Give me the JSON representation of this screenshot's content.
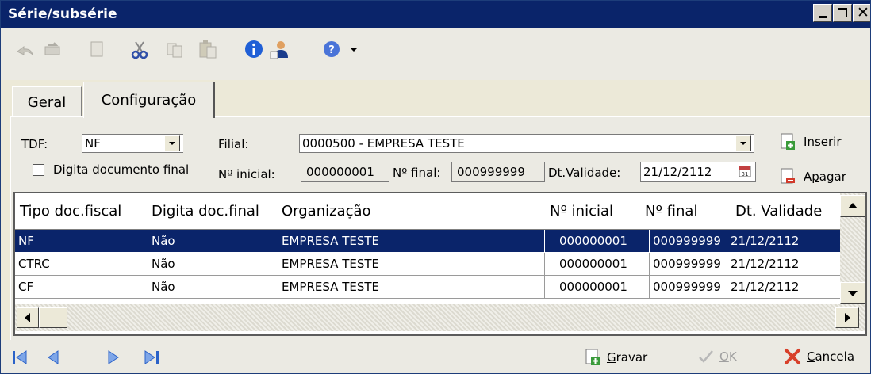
{
  "window": {
    "title": "Série/subsérie"
  },
  "toolbar": {
    "icons": [
      "undo-icon",
      "redo-icon",
      "new-document-icon",
      "cut-icon",
      "copy-icon",
      "paste-icon",
      "info-icon",
      "user-icon",
      "help-icon",
      "dropdown-arrow-icon"
    ]
  },
  "tabs": [
    {
      "label": "Geral",
      "active": false
    },
    {
      "label": "Configuração",
      "active": true
    }
  ],
  "form": {
    "tdf_label": "TDF:",
    "tdf_value": "NF",
    "filial_label": "Filial:",
    "filial_value": "0000500 - EMPRESA TESTE",
    "digita_label": "Digita documento final",
    "digita_checked": false,
    "num_inicial_label": "Nº inicial:",
    "num_inicial_value": "000000001",
    "num_final_label": "Nº final:",
    "num_final_value": "000999999",
    "validade_label": "Dt.Validade:",
    "validade_value": "21/12/2112"
  },
  "side_buttons": {
    "inserir_prefix": "",
    "inserir_underline": "I",
    "inserir_rest": "nserir",
    "apagar_prefix": "A",
    "apagar_underline": "p",
    "apagar_rest": "agar"
  },
  "grid": {
    "columns": [
      "Tipo doc.fiscal",
      "Digita doc.final",
      "Organização",
      "Nº inicial",
      "Nº final",
      "Dt. Validade"
    ],
    "rows": [
      {
        "tipo": "NF",
        "digita": "Não",
        "org": "EMPRESA TESTE",
        "inicial": "000000001",
        "final": "000999999",
        "validade": "21/12/2112",
        "selected": true
      },
      {
        "tipo": "CTRC",
        "digita": "Não",
        "org": "EMPRESA TESTE",
        "inicial": "000000001",
        "final": "000999999",
        "validade": "21/12/2112",
        "selected": false
      },
      {
        "tipo": "CF",
        "digita": "Não",
        "org": "EMPRESA TESTE",
        "inicial": "000000001",
        "final": "000999999",
        "validade": "21/12/2112",
        "selected": false
      }
    ]
  },
  "bottom": {
    "gravar_underline": "G",
    "gravar_rest": "ravar",
    "ok_underline": "O",
    "ok_rest": "K",
    "cancela_underline": "C",
    "cancela_rest": "ancela"
  },
  "colors": {
    "title_bar": "#0a246a",
    "selection": "#0a246a",
    "face": "#ebeae3"
  }
}
